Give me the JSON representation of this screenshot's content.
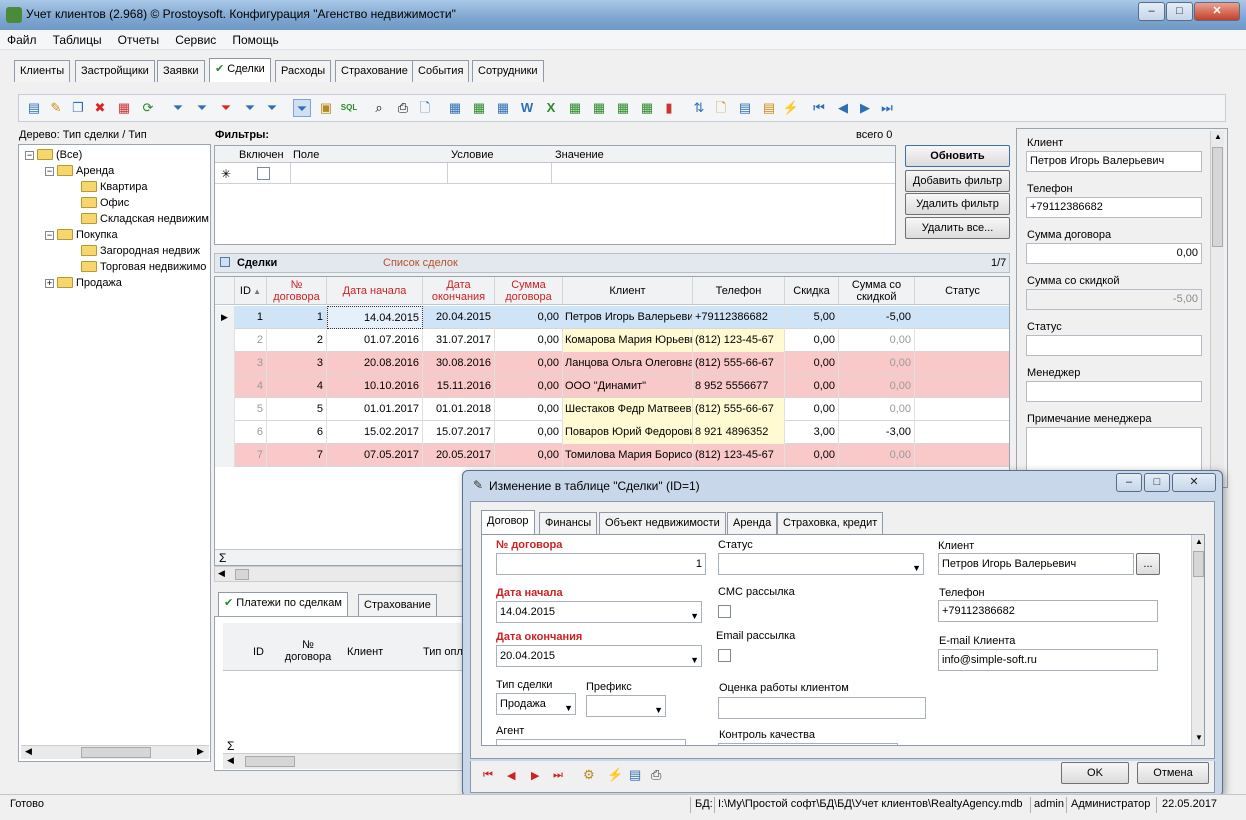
{
  "window": {
    "title": "Учет клиентов (2.968) © Prostoysoft. Конфигурация \"Агенство недвижимости\""
  },
  "menu": [
    "Файл",
    "Таблицы",
    "Отчеты",
    "Сервис",
    "Помощь"
  ],
  "main_tabs": [
    "Клиенты",
    "Застройщики",
    "Заявки",
    "Сделки",
    "Расходы",
    "Страхование",
    "События",
    "Сотрудники"
  ],
  "active_tab": "Сделки",
  "tree": {
    "label": "Дерево: Тип сделки / Тип",
    "items": [
      "(Все)",
      "Аренда",
      "Квартира",
      "Офис",
      "Складская недвижим",
      "Покупка",
      "Загородная недвиж",
      "Торговая недвижимо",
      "Продажа"
    ]
  },
  "filters": {
    "title": "Фильтры:",
    "count": "всего 0",
    "columns": [
      "Включен",
      "Поле",
      "Условие",
      "Значение"
    ],
    "buttons": {
      "refresh": "Обновить",
      "add": "Добавить фильтр",
      "delete": "Удалить фильтр",
      "delete_all": "Удалить все..."
    }
  },
  "deals": {
    "title": "Сделки",
    "subtitle": "Список сделок",
    "pager": "1/7",
    "columns": [
      "ID",
      "№ договора",
      "Дата начала",
      "Дата окончания",
      "Сумма договора",
      "Клиент",
      "Телефон",
      "Скидка",
      "Сумма со скидкой",
      "Статус"
    ],
    "rows": [
      {
        "id": "1",
        "num": "1",
        "start": "14.04.2015",
        "end": "20.04.2015",
        "sum": "0,00",
        "client": "Петров Игорь Валерьевич",
        "phone": "+79112386682",
        "disc": "5,00",
        "dsum": "-5,00",
        "status": ""
      },
      {
        "id": "2",
        "num": "2",
        "start": "01.07.2016",
        "end": "31.07.2017",
        "sum": "0,00",
        "client": "Комарова Мария Юрьевна",
        "phone": "(812) 123-45-67",
        "disc": "0,00",
        "dsum": "0,00",
        "status": ""
      },
      {
        "id": "3",
        "num": "3",
        "start": "20.08.2016",
        "end": "30.08.2016",
        "sum": "0,00",
        "client": "Ланцова Ольга Олеговна",
        "phone": "(812) 555-66-67",
        "disc": "0,00",
        "dsum": "0,00",
        "status": ""
      },
      {
        "id": "4",
        "num": "4",
        "start": "10.10.2016",
        "end": "15.11.2016",
        "sum": "0,00",
        "client": "ООО \"Динамит\"",
        "phone": "8 952 5556677",
        "disc": "0,00",
        "dsum": "0,00",
        "status": ""
      },
      {
        "id": "5",
        "num": "5",
        "start": "01.01.2017",
        "end": "01.01.2018",
        "sum": "0,00",
        "client": "Шестаков Федр Матвеевич",
        "phone": "(812) 555-66-67",
        "disc": "0,00",
        "dsum": "0,00",
        "status": ""
      },
      {
        "id": "6",
        "num": "6",
        "start": "15.02.2017",
        "end": "15.07.2017",
        "sum": "0,00",
        "client": "Поваров Юрий Федорович",
        "phone": "8 921 4896352",
        "disc": "3,00",
        "dsum": "-3,00",
        "status": ""
      },
      {
        "id": "7",
        "num": "7",
        "start": "07.05.2017",
        "end": "20.05.2017",
        "sum": "0,00",
        "client": "Томилова Мария Борисовна",
        "phone": "(812) 123-45-67",
        "disc": "0,00",
        "dsum": "0,00",
        "status": ""
      }
    ],
    "sigma": "Σ"
  },
  "bottom_tabs": [
    "Платежи по сделкам",
    "Страхование"
  ],
  "payments": {
    "columns": [
      "ID",
      "№ договора",
      "Клиент",
      "Тип опла"
    ],
    "sigma": "Σ"
  },
  "right_panel": {
    "client_label": "Клиент",
    "client": "Петров Игорь Валерьевич",
    "phone_label": "Телефон",
    "phone": "+79112386682",
    "sum_label": "Сумма договора",
    "sum": "0,00",
    "dsum_label": "Сумма со скидкой",
    "dsum": "-5,00",
    "status_label": "Статус",
    "manager_label": "Менеджер",
    "note_label": "Примечание менеджера"
  },
  "dialog": {
    "title": "Изменение в таблице \"Сделки\" (ID=1)",
    "tabs": [
      "Договор",
      "Финансы",
      "Объект недвижимости",
      "Аренда",
      "Страховка, кредит"
    ],
    "num_label": "№ договора",
    "num": "1",
    "start_label": "Дата начала",
    "start": "14.04.2015",
    "end_label": "Дата окончания",
    "end": "20.04.2015",
    "type_label": "Тип сделки",
    "type": "Продажа",
    "prefix_label": "Префикс",
    "agent_label": "Агент",
    "status_label": "Статус",
    "sms_label": "СМС рассылка",
    "email_label": "Email рассылка",
    "rating_label": "Оценка работы клиентом",
    "quality_label": "Контроль качества",
    "client_label": "Клиент",
    "client": "Петров Игорь Валерьевич",
    "client_btn": "...",
    "phone_label": "Телефон",
    "phone": "+79112386682",
    "email_client_label": "E-mail Клиента",
    "email_client": "info@simple-soft.ru",
    "ok": "OK",
    "cancel": "Отмена"
  },
  "statusbar": {
    "ready": "Готово",
    "db_label": "БД:",
    "db_path": "I:\\Мy\\Простой софт\\БД\\БД\\Учет клиентов\\RealtyAgency.mdb",
    "user": "admin",
    "role": "Администратор",
    "date": "22.05.2017"
  }
}
